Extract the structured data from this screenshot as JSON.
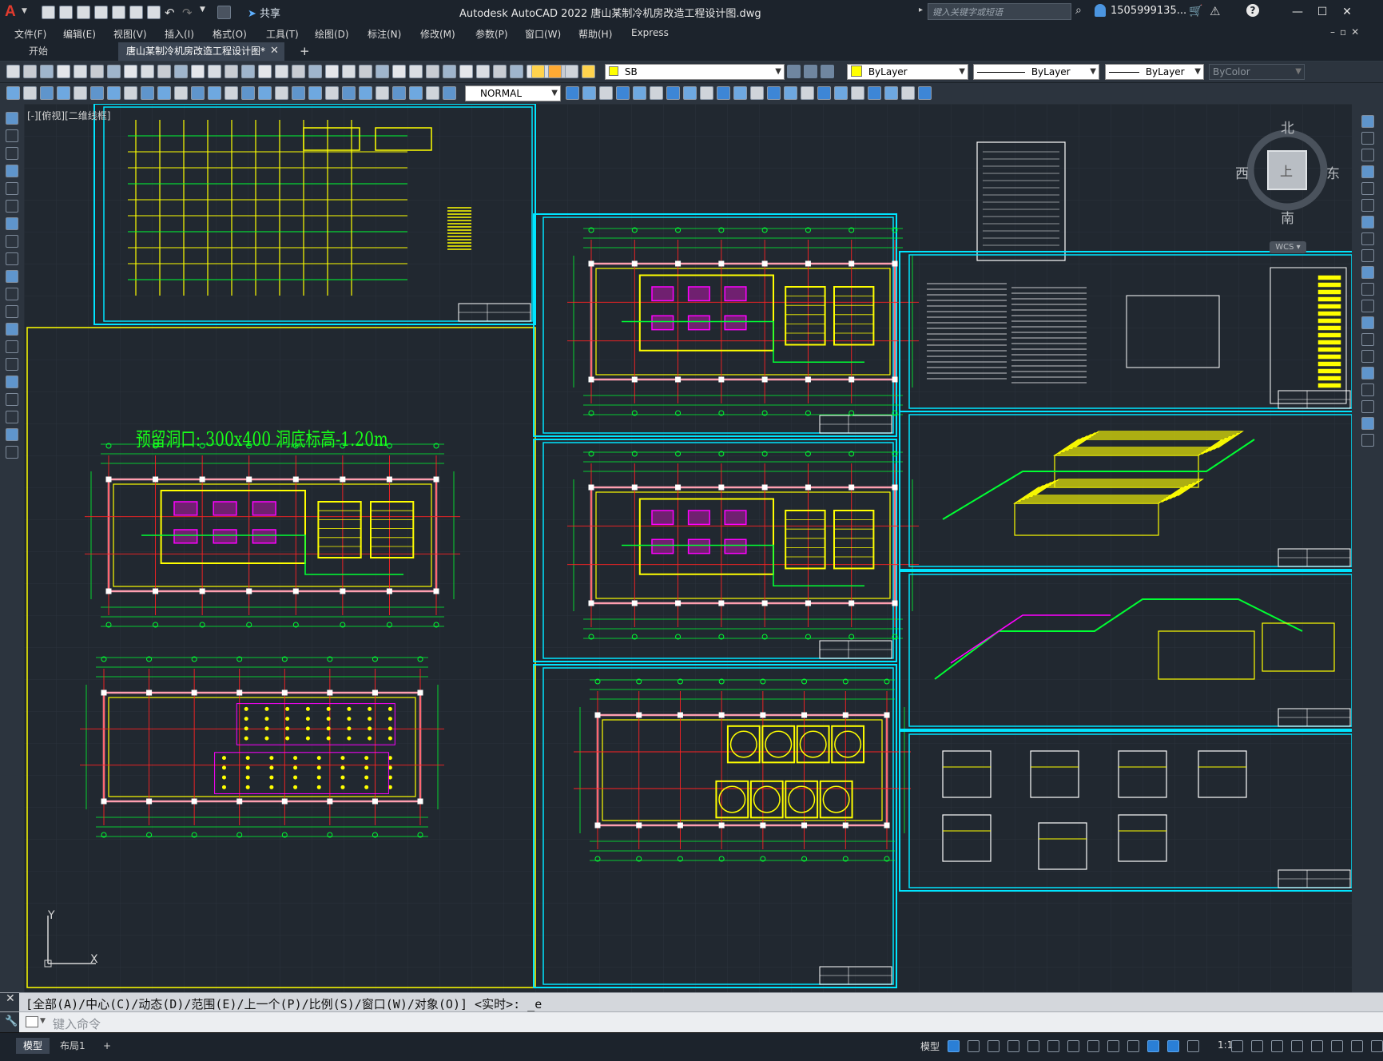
{
  "app": {
    "title": "Autodesk AutoCAD 2022    唐山某制冷机房改造工程设计图.dwg",
    "logo": "A",
    "share_label": "共享",
    "search_placeholder": "键入关键字或短语",
    "user": "1505999135...",
    "minimize": "—",
    "restore": "☐",
    "close": "✕"
  },
  "menu": [
    "文件(F)",
    "编辑(E)",
    "视图(V)",
    "插入(I)",
    "格式(O)",
    "工具(T)",
    "绘图(D)",
    "标注(N)",
    "修改(M)",
    "参数(P)",
    "窗口(W)",
    "帮助(H)",
    "Express"
  ],
  "tabs": {
    "start": "开始",
    "document": "唐山某制冷机房改造工程设计图*",
    "close": "✕",
    "add": "+"
  },
  "properties": {
    "layer": "SB",
    "color": "ByLayer",
    "linetype": "ByLayer",
    "lineweight": "ByLayer",
    "plotstyle": "ByColor",
    "dimstyle": "NORMAL"
  },
  "viewport": {
    "label": "[-][俯视][二维线框]",
    "annotation": "预留洞口:  300x400   洞底标高-1.20m",
    "ucs_x": "X",
    "ucs_y": "Y"
  },
  "viewcube": {
    "north": "北",
    "south": "南",
    "east": "东",
    "west": "西",
    "face": "上",
    "wcs": "WCS"
  },
  "command": {
    "history": "[全部(A)/中心(C)/动态(D)/范围(E)/上一个(P)/比例(S)/窗口(W)/对象(O)] <实时>: _e",
    "placeholder": "键入命令"
  },
  "status": {
    "model_tab": "模型",
    "layout_tab": "布局1",
    "add_tab": "+",
    "model_label": "模型",
    "scale": "1:1"
  },
  "colors": {
    "background": "#212830",
    "frame": "#00e5ff",
    "drawing_yellow": "#ffff00",
    "drawing_green": "#00ff33",
    "drawing_red": "#ff2222",
    "drawing_magenta": "#ff00ff",
    "text_green": "#19ff19"
  }
}
